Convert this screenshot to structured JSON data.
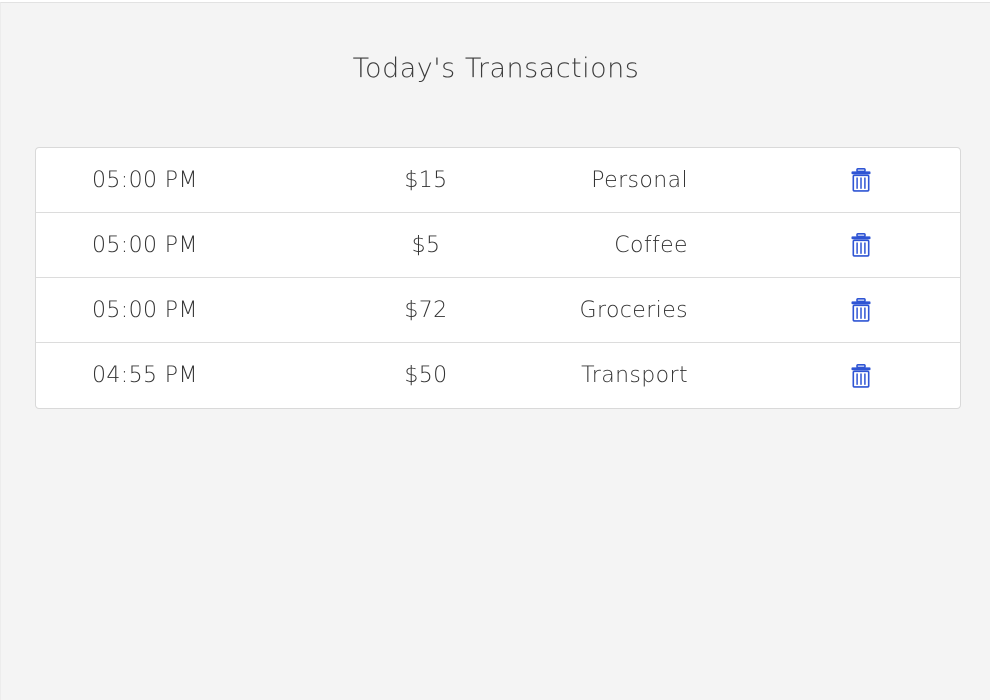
{
  "header": {
    "title": "Today's Transactions"
  },
  "transactions": [
    {
      "time": "05:00 PM",
      "amount": "$15",
      "category": "Personal"
    },
    {
      "time": "05:00 PM",
      "amount": "$5",
      "category": "Coffee"
    },
    {
      "time": "05:00 PM",
      "amount": "$72",
      "category": "Groceries"
    },
    {
      "time": "04:55 PM",
      "amount": "$50",
      "category": "Transport"
    }
  ],
  "icons": {
    "delete": "trash-icon"
  },
  "colors": {
    "accent": "#2f55d4"
  }
}
